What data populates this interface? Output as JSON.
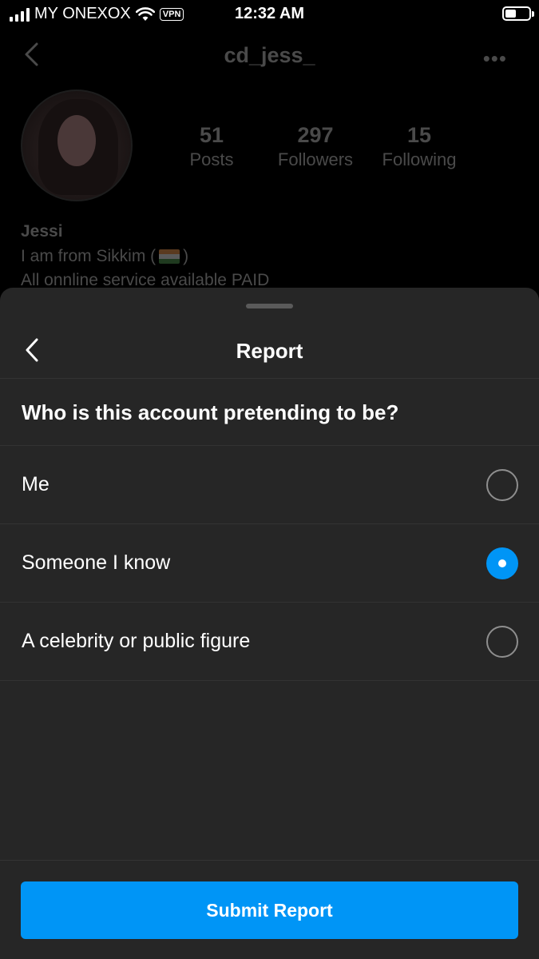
{
  "status_bar": {
    "carrier": "MY ONEXOX",
    "vpn": "VPN",
    "time": "12:32 AM",
    "battery_percent": 45
  },
  "profile": {
    "username": "cd_jess_",
    "more": "•••",
    "stats": [
      {
        "value": "51",
        "label": "Posts"
      },
      {
        "value": "297",
        "label": "Followers"
      },
      {
        "value": "15",
        "label": "Following"
      }
    ],
    "name": "Jessi",
    "bio_prefix": "I am from Sikkim (",
    "bio_suffix": ")",
    "bio_line2": "All onnline service available PAID"
  },
  "report_sheet": {
    "title": "Report",
    "question": "Who is this account pretending to be?",
    "options": [
      {
        "label": "Me",
        "selected": false
      },
      {
        "label": "Someone I know",
        "selected": true
      },
      {
        "label": "A celebrity or public figure",
        "selected": false
      }
    ],
    "submit_label": "Submit Report"
  },
  "colors": {
    "accent": "#0095f6",
    "sheet_background": "#262626",
    "dimmed_text": "#4a4a4a"
  },
  "icons": {
    "back": "chevron-left-icon",
    "more": "more-horizontal-icon",
    "signal": "cellular-signal-icon",
    "wifi": "wifi-icon",
    "battery": "battery-icon",
    "flag": "india-flag-icon"
  }
}
